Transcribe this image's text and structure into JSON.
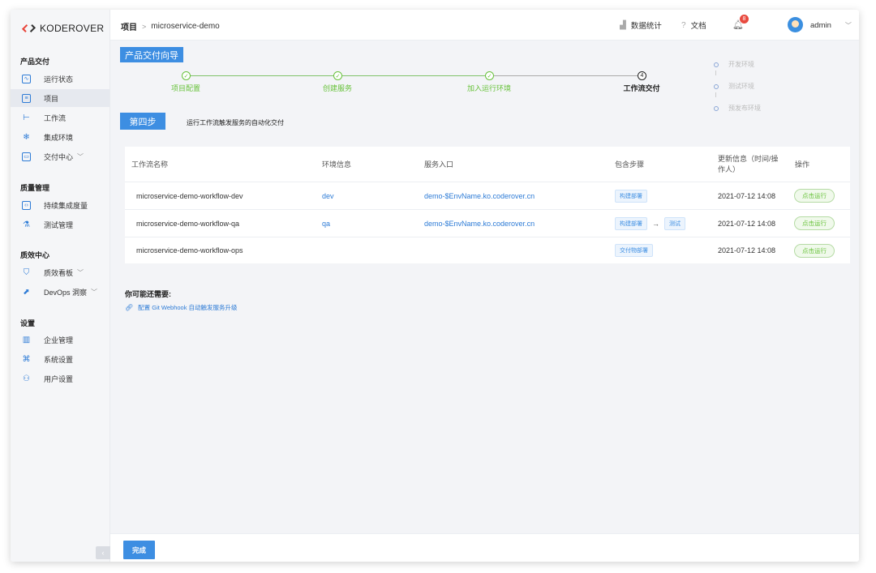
{
  "app": {
    "logo_text": "KODEROVER"
  },
  "sidebar": {
    "groups": [
      {
        "title": "产品交付",
        "items": [
          {
            "label": "运行状态",
            "icon": "pulse-icon"
          },
          {
            "label": "项目",
            "icon": "project-icon",
            "active": true
          },
          {
            "label": "工作流",
            "icon": "workflow-icon"
          },
          {
            "label": "集成环境",
            "icon": "snowflake-icon"
          },
          {
            "label": "交付中心",
            "icon": "delivery-icon",
            "expandable": true
          }
        ]
      },
      {
        "title": "质量管理",
        "items": [
          {
            "label": "持续集成度量",
            "icon": "code-icon"
          },
          {
            "label": "测试管理",
            "icon": "flask-icon"
          }
        ]
      },
      {
        "title": "质效中心",
        "items": [
          {
            "label": "质效看板",
            "icon": "shield-icon",
            "expandable": true
          },
          {
            "label": "DevOps 洞察",
            "icon": "chart-icon",
            "expandable": true
          }
        ]
      },
      {
        "title": "设置",
        "items": [
          {
            "label": "企业管理",
            "icon": "building-icon"
          },
          {
            "label": "系统设置",
            "icon": "command-icon"
          },
          {
            "label": "用户设置",
            "icon": "user-icon"
          }
        ]
      }
    ],
    "collapse_glyph": "‹"
  },
  "header": {
    "breadcrumb_root": "项目",
    "breadcrumb_sep": ">",
    "breadcrumb_current": "microservice-demo",
    "stats_label": "数据统计",
    "docs_label": "文档",
    "notification_count": "8",
    "user_name": "admin"
  },
  "wizard": {
    "title": "产品交付向导",
    "steps": [
      {
        "label": "项目配置",
        "state": "done"
      },
      {
        "label": "创建服务",
        "state": "done"
      },
      {
        "label": "加入运行环境",
        "state": "done"
      },
      {
        "label": "工作流交付",
        "state": "current",
        "number": "4"
      }
    ],
    "envs": [
      "开发环境",
      "测试环境",
      "预发布环境"
    ],
    "step_badge": "第四步",
    "step_desc": "运行工作流触发服务的自动化交付"
  },
  "table": {
    "headers": {
      "name": "工作流名称",
      "env": "环境信息",
      "entry": "服务入口",
      "steps": "包含步骤",
      "updated_line1": "更新信息（时间/操",
      "updated_line2": "作人）",
      "action": "操作"
    },
    "rows": [
      {
        "name": "microservice-demo-workflow-dev",
        "env": "dev",
        "entry": "demo-$EnvName.ko.coderover.cn",
        "steps": [
          "构建部署"
        ],
        "updated": "2021-07-12 14:08",
        "action": "点击运行"
      },
      {
        "name": "microservice-demo-workflow-qa",
        "env": "qa",
        "entry": "demo-$EnvName.ko.coderover.cn",
        "steps": [
          "构建部署",
          "测试"
        ],
        "updated": "2021-07-12 14:08",
        "action": "点击运行"
      },
      {
        "name": "microservice-demo-workflow-ops",
        "env": "",
        "entry": "",
        "steps": [
          "交付物部署"
        ],
        "updated": "2021-07-12 14:08",
        "action": "点击运行"
      }
    ]
  },
  "extra": {
    "title": "你可能还需要:",
    "link": "配置 Git Webhook 自动触发服务升级"
  },
  "footer": {
    "done_label": "完成"
  },
  "colors": {
    "primary": "#3d8ee2",
    "success": "#67c23a",
    "badge": "#e84a3f"
  }
}
